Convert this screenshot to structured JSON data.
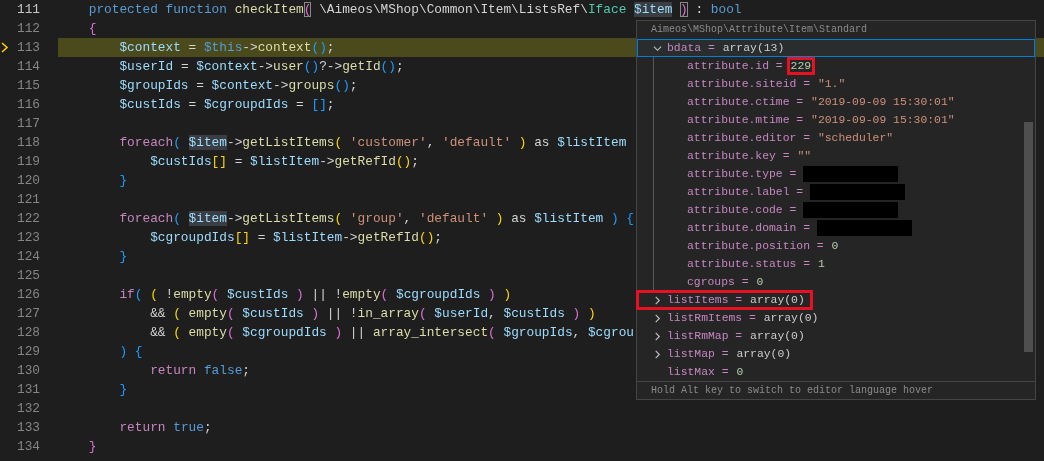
{
  "editor": {
    "lines": [
      {
        "number": "111",
        "cursor": true,
        "paused": false,
        "tokens": [
          {
            "text": "    protected function ",
            "kind": "keyword"
          },
          {
            "text": "checkItem",
            "kind": "function"
          },
          {
            "text": "(",
            "kind": "match"
          },
          {
            "text": " \\Aimeos\\MShop\\Common\\Item\\ListsRef\\",
            "kind": "plain"
          },
          {
            "text": "Iface ",
            "kind": "class"
          },
          {
            "text": "$item ",
            "kind": "hilite"
          },
          {
            "text": ")",
            "kind": "match"
          },
          {
            "text": " : ",
            "kind": "plain"
          },
          {
            "text": "bool",
            "kind": "keyword"
          }
        ]
      },
      {
        "number": "112",
        "cursor": false,
        "paused": false,
        "tokens": [
          {
            "text": "    {",
            "kind": "bracket2"
          }
        ]
      },
      {
        "number": "113",
        "cursor": false,
        "paused": true,
        "tokens": [
          {
            "text": "        $context",
            "kind": "variable"
          },
          {
            "text": " = ",
            "kind": "plain"
          },
          {
            "text": "$this",
            "kind": "keyword"
          },
          {
            "text": "->",
            "kind": "plain"
          },
          {
            "text": "context",
            "kind": "function"
          },
          {
            "text": "()",
            "kind": "bracket3"
          },
          {
            "text": ";",
            "kind": "plain"
          }
        ]
      },
      {
        "number": "114",
        "cursor": false,
        "paused": false,
        "tokens": [
          {
            "text": "        $userId",
            "kind": "variable"
          },
          {
            "text": " = ",
            "kind": "plain"
          },
          {
            "text": "$context",
            "kind": "variable"
          },
          {
            "text": "->",
            "kind": "plain"
          },
          {
            "text": "user",
            "kind": "function"
          },
          {
            "text": "()",
            "kind": "bracket3"
          },
          {
            "text": "?->",
            "kind": "plain"
          },
          {
            "text": "getId",
            "kind": "function"
          },
          {
            "text": "()",
            "kind": "bracket3"
          },
          {
            "text": ";",
            "kind": "plain"
          }
        ]
      },
      {
        "number": "115",
        "cursor": false,
        "paused": false,
        "tokens": [
          {
            "text": "        $groupIds",
            "kind": "variable"
          },
          {
            "text": " = ",
            "kind": "plain"
          },
          {
            "text": "$context",
            "kind": "variable"
          },
          {
            "text": "->",
            "kind": "plain"
          },
          {
            "text": "groups",
            "kind": "function"
          },
          {
            "text": "()",
            "kind": "bracket3"
          },
          {
            "text": ";",
            "kind": "plain"
          }
        ]
      },
      {
        "number": "116",
        "cursor": false,
        "paused": false,
        "tokens": [
          {
            "text": "        $custIds",
            "kind": "variable"
          },
          {
            "text": " = ",
            "kind": "plain"
          },
          {
            "text": "$cgroupdIds",
            "kind": "variable"
          },
          {
            "text": " = ",
            "kind": "plain"
          },
          {
            "text": "[]",
            "kind": "bracket3"
          },
          {
            "text": ";",
            "kind": "plain"
          }
        ]
      },
      {
        "number": "117",
        "cursor": false,
        "paused": false
      },
      {
        "number": "118",
        "cursor": false,
        "paused": false,
        "tokens": [
          {
            "text": "        foreach",
            "kind": "control"
          },
          {
            "text": "( ",
            "kind": "bracket3"
          },
          {
            "text": "$item",
            "kind": "hilite"
          },
          {
            "text": "->",
            "kind": "plain"
          },
          {
            "text": "getListItems",
            "kind": "function"
          },
          {
            "text": "( ",
            "kind": "bracket1"
          },
          {
            "text": "'customer'",
            "kind": "string"
          },
          {
            "text": ", ",
            "kind": "plain"
          },
          {
            "text": "'default' ",
            "kind": "string"
          },
          {
            "text": ")",
            "kind": "bracket1"
          },
          {
            "text": " as ",
            "kind": "plain"
          },
          {
            "text": "$listItem",
            "kind": "variable"
          }
        ]
      },
      {
        "number": "119",
        "cursor": false,
        "paused": false,
        "tokens": [
          {
            "text": "            $custIds",
            "kind": "variable"
          },
          {
            "text": "[]",
            "kind": "bracket1"
          },
          {
            "text": " = ",
            "kind": "plain"
          },
          {
            "text": "$listItem",
            "kind": "variable"
          },
          {
            "text": "->",
            "kind": "plain"
          },
          {
            "text": "getRefId",
            "kind": "function"
          },
          {
            "text": "()",
            "kind": "bracket1"
          },
          {
            "text": ";",
            "kind": "plain"
          }
        ]
      },
      {
        "number": "120",
        "cursor": false,
        "paused": false,
        "tokens": [
          {
            "text": "        }",
            "kind": "bracket3"
          }
        ]
      },
      {
        "number": "121",
        "cursor": false,
        "paused": false
      },
      {
        "number": "122",
        "cursor": false,
        "paused": false,
        "tokens": [
          {
            "text": "        foreach",
            "kind": "control"
          },
          {
            "text": "( ",
            "kind": "bracket3"
          },
          {
            "text": "$item",
            "kind": "hilite"
          },
          {
            "text": "->",
            "kind": "plain"
          },
          {
            "text": "getListItems",
            "kind": "function"
          },
          {
            "text": "( ",
            "kind": "bracket1"
          },
          {
            "text": "'group'",
            "kind": "string"
          },
          {
            "text": ", ",
            "kind": "plain"
          },
          {
            "text": "'default' ",
            "kind": "string"
          },
          {
            "text": ")",
            "kind": "bracket1"
          },
          {
            "text": " as ",
            "kind": "plain"
          },
          {
            "text": "$listItem ",
            "kind": "variable"
          },
          {
            "text": ") {",
            "kind": "bracket3"
          }
        ]
      },
      {
        "number": "123",
        "cursor": false,
        "paused": false,
        "tokens": [
          {
            "text": "            $cgroupdIds",
            "kind": "variable"
          },
          {
            "text": "[]",
            "kind": "bracket1"
          },
          {
            "text": " = ",
            "kind": "plain"
          },
          {
            "text": "$listItem",
            "kind": "variable"
          },
          {
            "text": "->",
            "kind": "plain"
          },
          {
            "text": "getRefId",
            "kind": "function"
          },
          {
            "text": "()",
            "kind": "bracket1"
          },
          {
            "text": ";",
            "kind": "plain"
          }
        ]
      },
      {
        "number": "124",
        "cursor": false,
        "paused": false,
        "tokens": [
          {
            "text": "        }",
            "kind": "bracket3"
          }
        ]
      },
      {
        "number": "125",
        "cursor": false,
        "paused": false
      },
      {
        "number": "126",
        "cursor": false,
        "paused": false,
        "tokens": [
          {
            "text": "        if",
            "kind": "control"
          },
          {
            "text": "( ",
            "kind": "bracket3"
          },
          {
            "text": "(",
            "kind": "bracket1"
          },
          {
            "text": " !",
            "kind": "plain"
          },
          {
            "text": "empty",
            "kind": "function"
          },
          {
            "text": "( ",
            "kind": "bracket2"
          },
          {
            "text": "$custIds ",
            "kind": "variable"
          },
          {
            "text": ")",
            "kind": "bracket2"
          },
          {
            "text": " || !",
            "kind": "plain"
          },
          {
            "text": "empty",
            "kind": "function"
          },
          {
            "text": "( ",
            "kind": "bracket2"
          },
          {
            "text": "$cgroupdIds ",
            "kind": "variable"
          },
          {
            "text": ") ",
            "kind": "bracket2"
          },
          {
            "text": ")",
            "kind": "bracket1"
          }
        ]
      },
      {
        "number": "127",
        "cursor": false,
        "paused": false,
        "tokens": [
          {
            "text": "            && ",
            "kind": "plain"
          },
          {
            "text": "( ",
            "kind": "bracket1"
          },
          {
            "text": "empty",
            "kind": "function"
          },
          {
            "text": "( ",
            "kind": "bracket2"
          },
          {
            "text": "$custIds ",
            "kind": "variable"
          },
          {
            "text": ")",
            "kind": "bracket2"
          },
          {
            "text": " || !",
            "kind": "plain"
          },
          {
            "text": "in_array",
            "kind": "function"
          },
          {
            "text": "( ",
            "kind": "bracket2"
          },
          {
            "text": "$userId",
            "kind": "variable"
          },
          {
            "text": ", ",
            "kind": "plain"
          },
          {
            "text": "$custIds ",
            "kind": "variable"
          },
          {
            "text": ") ",
            "kind": "bracket2"
          },
          {
            "text": ")",
            "kind": "bracket1"
          }
        ]
      },
      {
        "number": "128",
        "cursor": false,
        "paused": false,
        "tokens": [
          {
            "text": "            && ",
            "kind": "plain"
          },
          {
            "text": "( ",
            "kind": "bracket1"
          },
          {
            "text": "empty",
            "kind": "function"
          },
          {
            "text": "( ",
            "kind": "bracket2"
          },
          {
            "text": "$cgroupdIds ",
            "kind": "variable"
          },
          {
            "text": ")",
            "kind": "bracket2"
          },
          {
            "text": " || ",
            "kind": "plain"
          },
          {
            "text": "array_intersect",
            "kind": "function"
          },
          {
            "text": "( ",
            "kind": "bracket2"
          },
          {
            "text": "$groupIds",
            "kind": "variable"
          },
          {
            "text": ", ",
            "kind": "plain"
          },
          {
            "text": "$cgrou",
            "kind": "variable"
          }
        ]
      },
      {
        "number": "129",
        "cursor": false,
        "paused": false,
        "tokens": [
          {
            "text": "        ) {",
            "kind": "bracket3"
          }
        ]
      },
      {
        "number": "130",
        "cursor": false,
        "paused": false,
        "tokens": [
          {
            "text": "            return ",
            "kind": "control"
          },
          {
            "text": "false",
            "kind": "keyword"
          },
          {
            "text": ";",
            "kind": "plain"
          }
        ]
      },
      {
        "number": "131",
        "cursor": false,
        "paused": false,
        "tokens": [
          {
            "text": "        }",
            "kind": "bracket3"
          }
        ]
      },
      {
        "number": "132",
        "cursor": false,
        "paused": false
      },
      {
        "number": "133",
        "cursor": false,
        "paused": false,
        "tokens": [
          {
            "text": "        return ",
            "kind": "control"
          },
          {
            "text": "true",
            "kind": "keyword"
          },
          {
            "text": ";",
            "kind": "plain"
          }
        ]
      },
      {
        "number": "134",
        "cursor": false,
        "paused": false,
        "tokens": [
          {
            "text": "    }",
            "kind": "bracket2"
          }
        ]
      }
    ]
  },
  "hover": {
    "type_name": "Aimeos\\MShop\\Attribute\\Item\\Standard",
    "footer": "Hold Alt key to switch to editor language hover",
    "rows": [
      {
        "kind": "group",
        "name": "bdata =",
        "value": "array(13)",
        "expanded": true,
        "selected": true,
        "children": [
          {
            "kind": "number",
            "name": "attribute.id =",
            "value": "229",
            "marked": true
          },
          {
            "kind": "string",
            "name": "attribute.siteid =",
            "value": "\"1.\""
          },
          {
            "kind": "string",
            "name": "attribute.ctime =",
            "value": "\"2019-09-09 15:30:01\""
          },
          {
            "kind": "string",
            "name": "attribute.mtime =",
            "value": "\"2019-09-09 15:30:01\""
          },
          {
            "kind": "string",
            "name": "attribute.editor =",
            "value": "\"scheduler\""
          },
          {
            "kind": "string",
            "name": "attribute.key =",
            "value": "\"\""
          },
          {
            "kind": "redacted",
            "name": "attribute.type ="
          },
          {
            "kind": "redacted",
            "name": "attribute.label ="
          },
          {
            "kind": "redacted",
            "name": "attribute.code ="
          },
          {
            "kind": "redacted",
            "name": "attribute.domain ="
          },
          {
            "kind": "number",
            "name": "attribute.position =",
            "value": "0"
          },
          {
            "kind": "number",
            "name": "attribute.status =",
            "value": "1"
          },
          {
            "kind": "number",
            "name": "cgroups =",
            "value": "0"
          }
        ]
      },
      {
        "kind": "group",
        "name": "listItems =",
        "value": "array(0)",
        "expanded": false,
        "selected": false,
        "marked": true
      },
      {
        "kind": "group",
        "name": "listRmItems =",
        "value": "array(0)",
        "expanded": false,
        "selected": false
      },
      {
        "kind": "group",
        "name": "listRmMap =",
        "value": "array(0)",
        "expanded": false,
        "selected": false
      },
      {
        "kind": "group",
        "name": "listMap =",
        "value": "array(0)",
        "expanded": false,
        "selected": false
      },
      {
        "kind": "number",
        "name": "listMax =",
        "value": "0"
      }
    ]
  }
}
